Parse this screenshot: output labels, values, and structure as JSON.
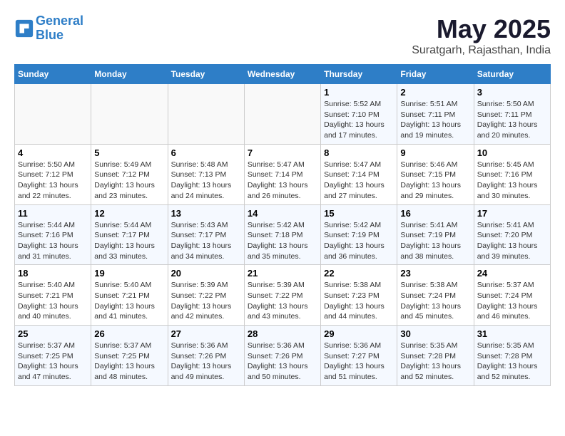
{
  "header": {
    "logo_line1": "General",
    "logo_line2": "Blue",
    "month_year": "May 2025",
    "location": "Suratgarh, Rajasthan, India"
  },
  "days_of_week": [
    "Sunday",
    "Monday",
    "Tuesday",
    "Wednesday",
    "Thursday",
    "Friday",
    "Saturday"
  ],
  "weeks": [
    [
      {
        "day": "",
        "info": ""
      },
      {
        "day": "",
        "info": ""
      },
      {
        "day": "",
        "info": ""
      },
      {
        "day": "",
        "info": ""
      },
      {
        "day": "1",
        "info": "Sunrise: 5:52 AM\nSunset: 7:10 PM\nDaylight: 13 hours and 17 minutes."
      },
      {
        "day": "2",
        "info": "Sunrise: 5:51 AM\nSunset: 7:11 PM\nDaylight: 13 hours and 19 minutes."
      },
      {
        "day": "3",
        "info": "Sunrise: 5:50 AM\nSunset: 7:11 PM\nDaylight: 13 hours and 20 minutes."
      }
    ],
    [
      {
        "day": "4",
        "info": "Sunrise: 5:50 AM\nSunset: 7:12 PM\nDaylight: 13 hours and 22 minutes."
      },
      {
        "day": "5",
        "info": "Sunrise: 5:49 AM\nSunset: 7:12 PM\nDaylight: 13 hours and 23 minutes."
      },
      {
        "day": "6",
        "info": "Sunrise: 5:48 AM\nSunset: 7:13 PM\nDaylight: 13 hours and 24 minutes."
      },
      {
        "day": "7",
        "info": "Sunrise: 5:47 AM\nSunset: 7:14 PM\nDaylight: 13 hours and 26 minutes."
      },
      {
        "day": "8",
        "info": "Sunrise: 5:47 AM\nSunset: 7:14 PM\nDaylight: 13 hours and 27 minutes."
      },
      {
        "day": "9",
        "info": "Sunrise: 5:46 AM\nSunset: 7:15 PM\nDaylight: 13 hours and 29 minutes."
      },
      {
        "day": "10",
        "info": "Sunrise: 5:45 AM\nSunset: 7:16 PM\nDaylight: 13 hours and 30 minutes."
      }
    ],
    [
      {
        "day": "11",
        "info": "Sunrise: 5:44 AM\nSunset: 7:16 PM\nDaylight: 13 hours and 31 minutes."
      },
      {
        "day": "12",
        "info": "Sunrise: 5:44 AM\nSunset: 7:17 PM\nDaylight: 13 hours and 33 minutes."
      },
      {
        "day": "13",
        "info": "Sunrise: 5:43 AM\nSunset: 7:17 PM\nDaylight: 13 hours and 34 minutes."
      },
      {
        "day": "14",
        "info": "Sunrise: 5:42 AM\nSunset: 7:18 PM\nDaylight: 13 hours and 35 minutes."
      },
      {
        "day": "15",
        "info": "Sunrise: 5:42 AM\nSunset: 7:19 PM\nDaylight: 13 hours and 36 minutes."
      },
      {
        "day": "16",
        "info": "Sunrise: 5:41 AM\nSunset: 7:19 PM\nDaylight: 13 hours and 38 minutes."
      },
      {
        "day": "17",
        "info": "Sunrise: 5:41 AM\nSunset: 7:20 PM\nDaylight: 13 hours and 39 minutes."
      }
    ],
    [
      {
        "day": "18",
        "info": "Sunrise: 5:40 AM\nSunset: 7:21 PM\nDaylight: 13 hours and 40 minutes."
      },
      {
        "day": "19",
        "info": "Sunrise: 5:40 AM\nSunset: 7:21 PM\nDaylight: 13 hours and 41 minutes."
      },
      {
        "day": "20",
        "info": "Sunrise: 5:39 AM\nSunset: 7:22 PM\nDaylight: 13 hours and 42 minutes."
      },
      {
        "day": "21",
        "info": "Sunrise: 5:39 AM\nSunset: 7:22 PM\nDaylight: 13 hours and 43 minutes."
      },
      {
        "day": "22",
        "info": "Sunrise: 5:38 AM\nSunset: 7:23 PM\nDaylight: 13 hours and 44 minutes."
      },
      {
        "day": "23",
        "info": "Sunrise: 5:38 AM\nSunset: 7:24 PM\nDaylight: 13 hours and 45 minutes."
      },
      {
        "day": "24",
        "info": "Sunrise: 5:37 AM\nSunset: 7:24 PM\nDaylight: 13 hours and 46 minutes."
      }
    ],
    [
      {
        "day": "25",
        "info": "Sunrise: 5:37 AM\nSunset: 7:25 PM\nDaylight: 13 hours and 47 minutes."
      },
      {
        "day": "26",
        "info": "Sunrise: 5:37 AM\nSunset: 7:25 PM\nDaylight: 13 hours and 48 minutes."
      },
      {
        "day": "27",
        "info": "Sunrise: 5:36 AM\nSunset: 7:26 PM\nDaylight: 13 hours and 49 minutes."
      },
      {
        "day": "28",
        "info": "Sunrise: 5:36 AM\nSunset: 7:26 PM\nDaylight: 13 hours and 50 minutes."
      },
      {
        "day": "29",
        "info": "Sunrise: 5:36 AM\nSunset: 7:27 PM\nDaylight: 13 hours and 51 minutes."
      },
      {
        "day": "30",
        "info": "Sunrise: 5:35 AM\nSunset: 7:28 PM\nDaylight: 13 hours and 52 minutes."
      },
      {
        "day": "31",
        "info": "Sunrise: 5:35 AM\nSunset: 7:28 PM\nDaylight: 13 hours and 52 minutes."
      }
    ]
  ]
}
